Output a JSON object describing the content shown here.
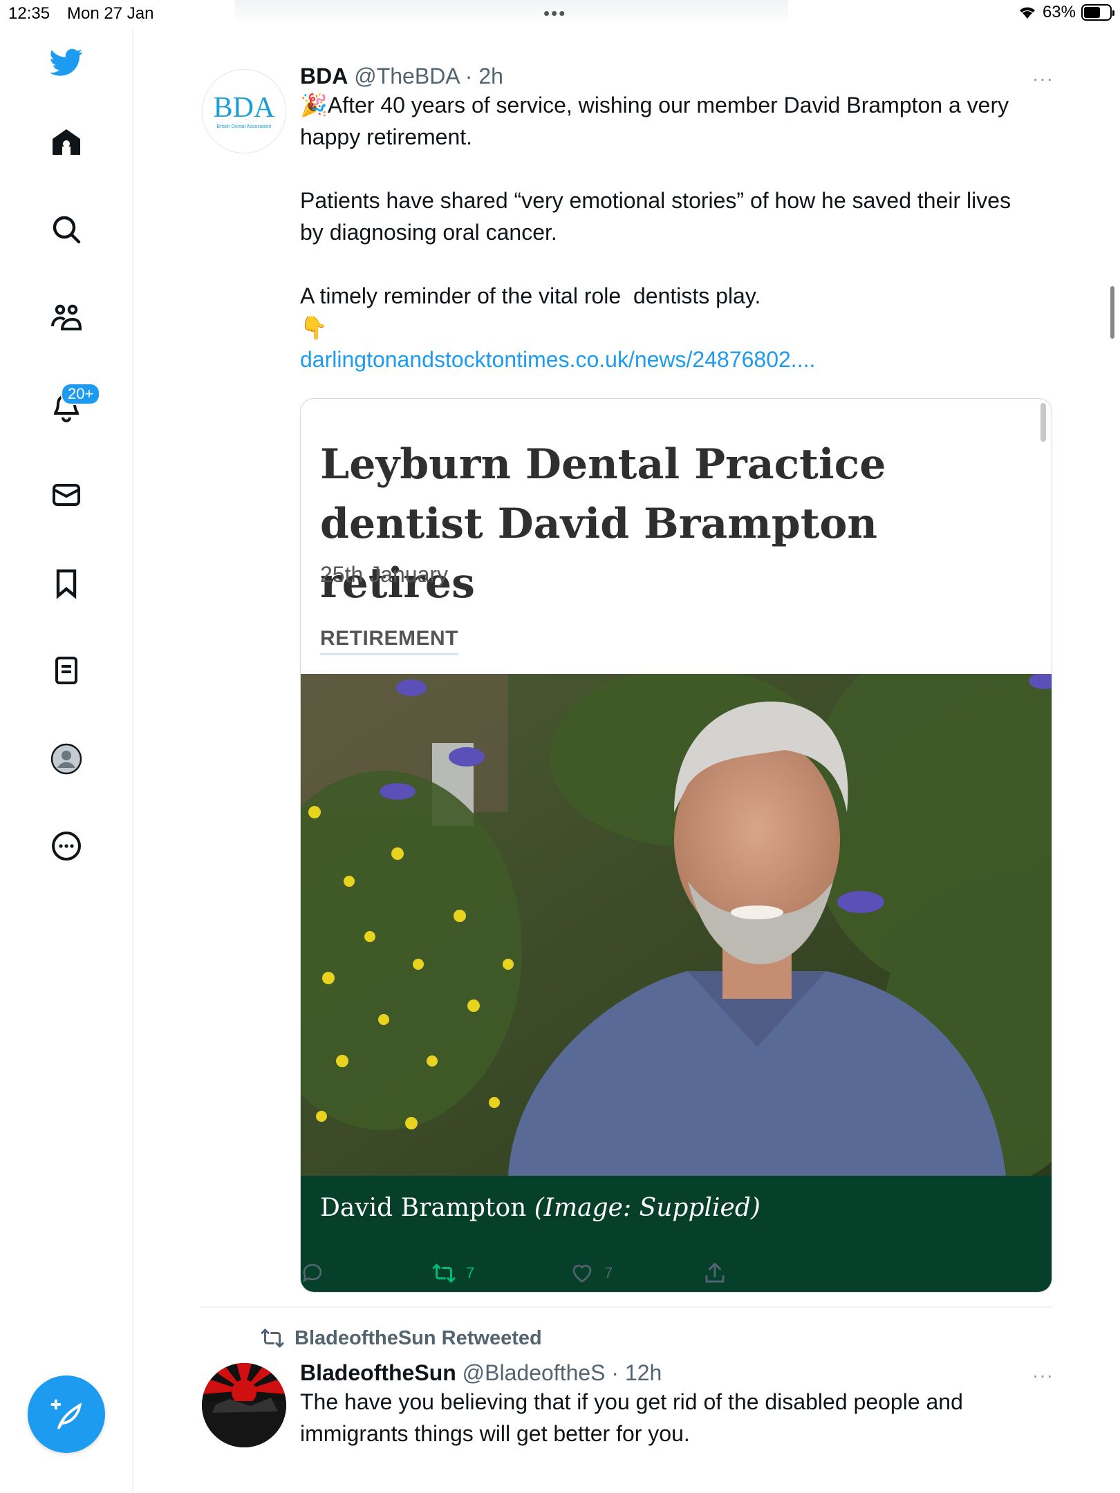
{
  "status_bar": {
    "time": "12:35",
    "date": "Mon 27 Jan",
    "battery": "63%",
    "battery_level": 0.63,
    "dots": "•••"
  },
  "nav": {
    "items": [
      {
        "name": "twitter-logo",
        "icon": "bird-icon"
      },
      {
        "name": "home",
        "icon": "home-icon"
      },
      {
        "name": "explore",
        "icon": "search-icon"
      },
      {
        "name": "communities",
        "icon": "people-icon"
      },
      {
        "name": "notifications",
        "icon": "bell-icon"
      },
      {
        "name": "messages",
        "icon": "envelope-icon"
      },
      {
        "name": "bookmarks",
        "icon": "bookmark-icon"
      },
      {
        "name": "lists",
        "icon": "list-icon"
      },
      {
        "name": "profile",
        "icon": "avatar-icon"
      },
      {
        "name": "more",
        "icon": "more-circle-icon"
      }
    ],
    "notification_badge": "20+",
    "compose_icon": "compose-feather-icon"
  },
  "tweet1": {
    "avatar_text": "BDA",
    "avatar_subtext": "British Dental Association",
    "name": "BDA",
    "handle": "@TheBDA · 2h",
    "more": "···",
    "emoji_party": "🎉",
    "text_1": "After 40 years of service, wishing our member David Brampton a very happy retirement.",
    "text_2": "Patients have shared “very emotional stories” of how he saved their lives by diagnosing oral cancer.",
    "text_3": "A timely reminder of the vital role  dentists play.",
    "emoji_point": "👇",
    "link": "darlingtonandstocktontimes.co.uk/news/24876802....",
    "card": {
      "title": "Leyburn Dental Practice dentist David Brampton retires",
      "date": "25th January",
      "tag": "RETIREMENT",
      "caption_name": "David Brampton",
      "caption_credit": "(Image: Supplied)"
    },
    "actions": {
      "reply_count": "",
      "retweet_count": "7",
      "like_count": "7",
      "retweet_color": "#00ba7c"
    }
  },
  "tweet2": {
    "retweeted_by": "BladeoftheSun Retweeted",
    "name": "BladeoftheSun",
    "handle": "@BladeoftheS · 12h",
    "more": "···",
    "text": "The have you believing that if you get rid of the disabled people and immigrants things will get better for you."
  },
  "colors": {
    "accent": "#1d9bf0",
    "caption_bg": "#06402b"
  }
}
